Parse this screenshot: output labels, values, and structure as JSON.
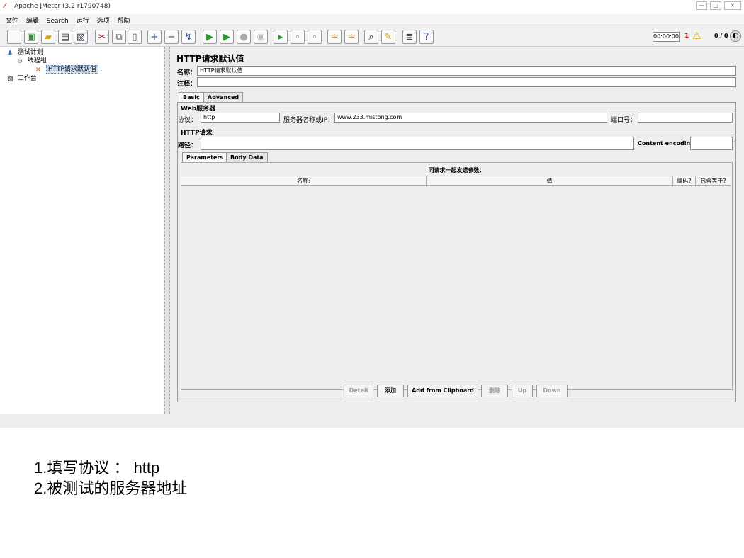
{
  "window": {
    "title": "Apache JMeter (3.2 r1790748)",
    "controls": [
      "—",
      "□",
      "✕"
    ]
  },
  "menu": [
    "文件",
    "编辑",
    "Search",
    "运行",
    "选项",
    "帮助"
  ],
  "toolbar": {
    "timer": "00:00:00",
    "error_count": "1",
    "thread_ratio": "0 / 0",
    "icons": [
      "new-icon",
      "templates-icon",
      "open-icon",
      "save-icon",
      "save-as-icon",
      "cut-icon",
      "copy-icon",
      "paste-icon",
      "expand-icon",
      "collapse-icon",
      "toggle-icon",
      "start-icon",
      "start-no-pause-icon",
      "stop-icon",
      "shutdown-icon",
      "remote-start-icon",
      "remote-stop-icon",
      "remote-shutdown-icon",
      "clear-icon",
      "clear-all-icon",
      "search-icon",
      "reset-search-icon",
      "function-helper-icon",
      "help-icon"
    ]
  },
  "tree": {
    "items": [
      {
        "label": "测试计划",
        "icon": "test-plan-icon"
      },
      {
        "label": "线程组",
        "icon": "thread-group-icon"
      },
      {
        "label": "HTTP请求默认值",
        "icon": "config-element-icon"
      },
      {
        "label": "工作台",
        "icon": "workbench-icon"
      }
    ]
  },
  "panel": {
    "title": "HTTP请求默认值",
    "name_label": "名称：",
    "name_value": "HTTP请求默认值",
    "comment_label": "注释：",
    "comment_value": "",
    "tabs": [
      "Basic",
      "Advanced"
    ],
    "web_server": {
      "legend": "Web服务器",
      "protocol_label": "协议：",
      "protocol_value": "http",
      "server_label": "服务器名称或IP：",
      "server_value": "www.233.mistong.com",
      "port_label": "端口号：",
      "port_value": ""
    },
    "http_request": {
      "legend": "HTTP请求",
      "path_label": "路径：",
      "path_value": "",
      "encoding_label": "Content encoding:",
      "encoding_value": ""
    },
    "sub_tabs": [
      "Parameters",
      "Body Data"
    ],
    "params": {
      "caption": "同请求一起发送参数：",
      "columns": [
        "名称:",
        "值",
        "编码?",
        "包含等于?"
      ]
    },
    "buttons": [
      "Detail",
      "添加",
      "Add from Clipboard",
      "删除",
      "Up",
      "Down"
    ]
  },
  "notes": [
    "1.填写协议 ： http",
    "2.被测试的服务器地址"
  ]
}
